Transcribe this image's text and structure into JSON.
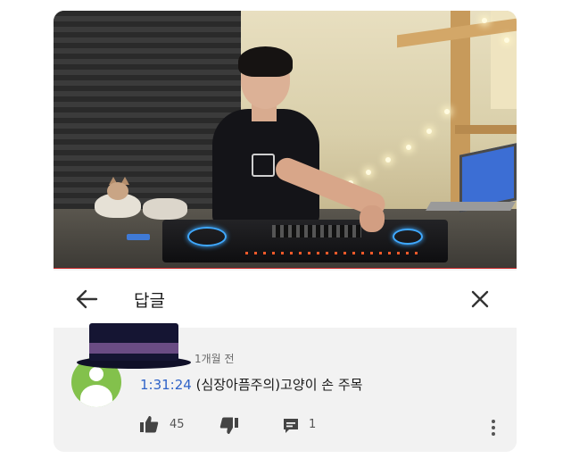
{
  "reply_panel": {
    "title": "답글",
    "back_icon": "arrow-left-icon",
    "close_icon": "close-icon"
  },
  "comment": {
    "time_ago": "1개월 전",
    "timestamp_link": "1:31:24",
    "text": " (심장아픔주의)고양이 손 주목",
    "like_count": "45",
    "reply_count": "1",
    "icons": [
      "thumb-up-icon",
      "thumb-down-icon",
      "reply-icon",
      "more-vert-icon"
    ]
  },
  "colors": {
    "timestamp_link": "#2f63c8",
    "avatar": "#83c14c",
    "progress_bar": "#cc2a2a"
  }
}
